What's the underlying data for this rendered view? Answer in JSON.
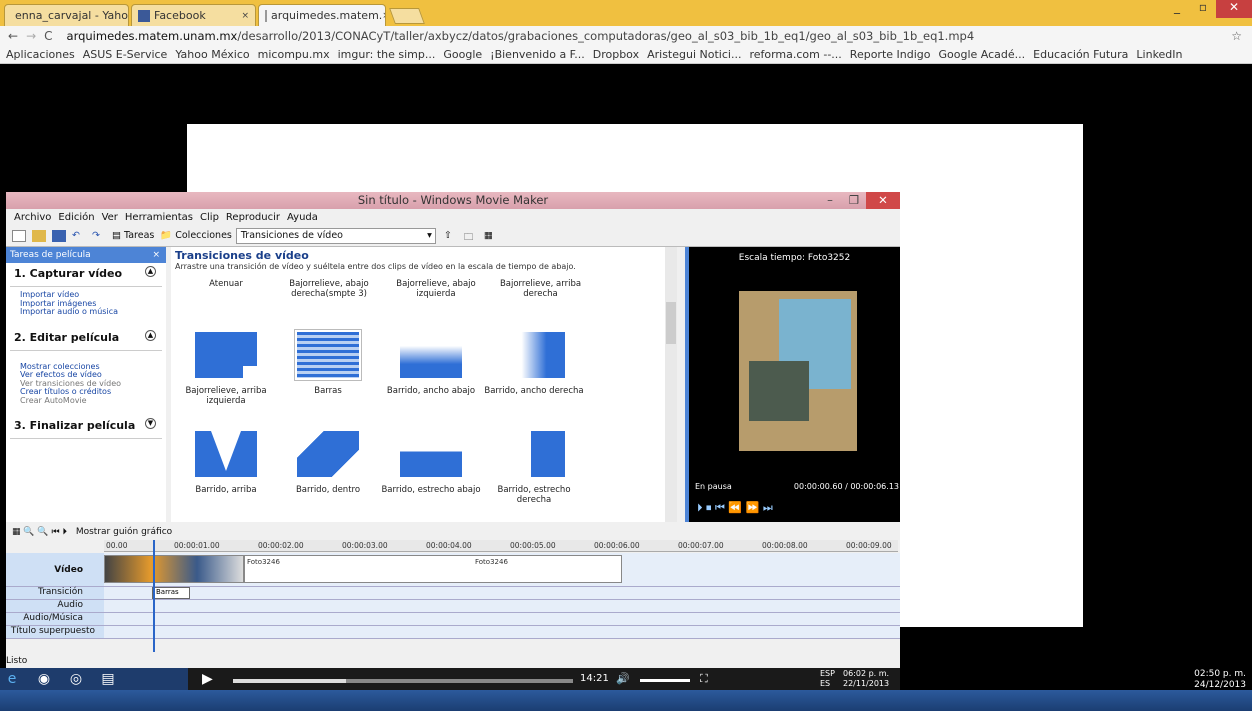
{
  "browser": {
    "tabs": [
      {
        "label": "enna_carvajal - Yaho",
        "close": "×"
      },
      {
        "label": "Facebook",
        "close": "×"
      },
      {
        "label": "arquimedes.matem.",
        "close": "×"
      }
    ],
    "url_host": "arquimedes.matem.unam.mx",
    "url_path": "/desarrollo/2013/CONACyT/taller/axbycz/datos/grabaciones_computadoras/geo_al_s03_bib_1b_eq1/geo_al_s03_bib_1b_eq1.mp4",
    "bookmarks": [
      "Aplicaciones",
      "ASUS E-Service",
      "Yahoo México",
      "micompu.mx",
      "imgur: the simp...",
      "Google",
      "¡Bienvenido a F...",
      "Dropbox",
      "Aristegui Notici...",
      "reforma.com --...",
      "Reporte Indigo",
      "Google Acadé...",
      "Educación Futura",
      "LinkedIn"
    ]
  },
  "wmm": {
    "title": "Sin título - Windows Movie Maker",
    "menu": [
      "Archivo",
      "Edición",
      "Ver",
      "Herramientas",
      "Clip",
      "Reproducir",
      "Ayuda"
    ],
    "toolbar": {
      "tareas": "Tareas",
      "colecciones": "Colecciones",
      "combo": "Transiciones de vídeo"
    },
    "tasks": {
      "header": "Tareas de película",
      "close": "×",
      "sections": [
        {
          "title": "1. Capturar vídeo",
          "links": [
            "Importar vídeo",
            "Importar imágenes",
            "Importar audio o música"
          ]
        },
        {
          "title": "2. Editar película",
          "links": [
            "Mostrar colecciones",
            "Ver efectos de vídeo",
            "Ver transiciones de vídeo",
            "Crear títulos o créditos",
            "Crear AutoMovie"
          ]
        },
        {
          "title": "3. Finalizar película",
          "links": []
        }
      ]
    },
    "gallery": {
      "title": "Transiciones de vídeo",
      "subtitle": "Arrastre una transición de vídeo y suéltela entre dos clips de vídeo en la escala de tiempo de abajo.",
      "top_labels": [
        "Atenuar",
        "Bajorrelieve, abajo derecha(smpte 3)",
        "Bajorrelieve, abajo izquierda",
        "Bajorrelieve, arriba derecha"
      ],
      "items": [
        "Bajorrelieve, arriba izquierda",
        "Barras",
        "Barrido, ancho abajo",
        "Barrido, ancho derecha",
        "Barrido, arriba",
        "Barrido, dentro",
        "Barrido, estrecho abajo",
        "Barrido, estrecho derecha"
      ]
    },
    "preview": {
      "title": "Escala tiempo: Foto3252",
      "status": "En pausa",
      "time": "00:00:00.60 / 00:00:06.13"
    },
    "storyboard_label": "Mostrar guión gráfico",
    "ruler": [
      "00.00",
      "00:00:01.00",
      "00:00:02.00",
      "00:00:03.00",
      "00:00:04.00",
      "00:00:05.00",
      "00:00:06.00",
      "00:00:07.00",
      "00:00:08.00",
      "00:00:09.00"
    ],
    "tracks": [
      "Vídeo",
      "Transición",
      "Audio",
      "Audio/Música",
      "Título superpuesto"
    ],
    "clips": [
      "Foto3246",
      "Foto3246"
    ],
    "transition_clip": "Barras",
    "status": "Listo"
  },
  "player": {
    "time": "14:21"
  },
  "tray": {
    "lang1": "ESP",
    "lang2": "ES",
    "inner_time": "06:02 p. m.",
    "inner_date": "22/11/2013",
    "time": "02:50 p. m.",
    "date": "24/12/2013"
  }
}
